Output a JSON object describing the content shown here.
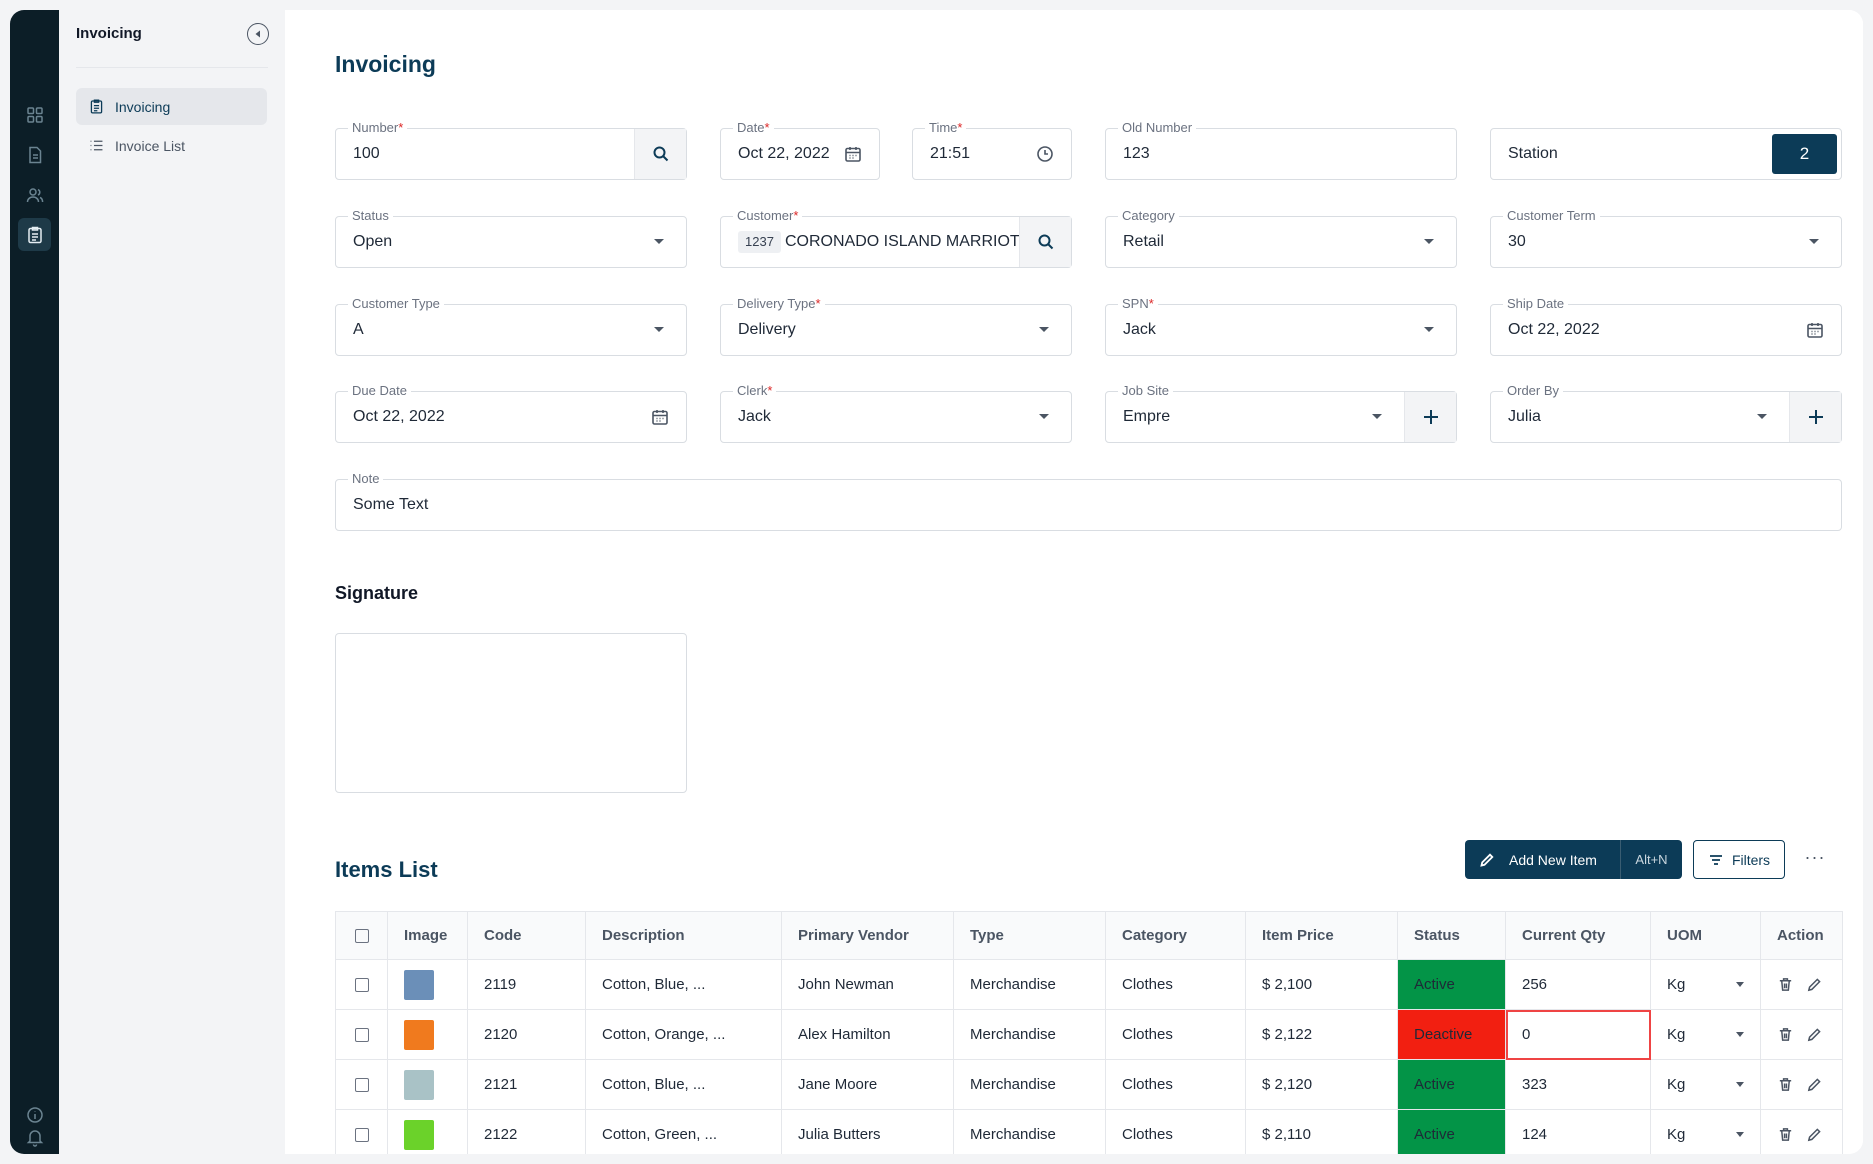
{
  "sidebar": {
    "title": "Invoicing",
    "items": [
      {
        "label": "Invoicing",
        "icon": "clipboard-icon",
        "active": true
      },
      {
        "label": "Invoice List",
        "icon": "list-icon",
        "active": false
      }
    ]
  },
  "rail": {
    "icons": [
      "grid-icon",
      "document-icon",
      "users-icon",
      "clipboard-icon",
      "info-icon",
      "bell-icon"
    ]
  },
  "page": {
    "title": "Invoicing"
  },
  "form": {
    "number": {
      "label": "Number",
      "value": "100"
    },
    "date": {
      "label": "Date",
      "value": "Oct 22, 2022"
    },
    "time": {
      "label": "Time",
      "value": "21:51"
    },
    "old_number": {
      "label": "Old Number",
      "value": "123"
    },
    "station": {
      "label": "Station",
      "value": "2"
    },
    "status": {
      "label": "Status",
      "value": "Open"
    },
    "customer": {
      "label": "Customer",
      "code": "1237",
      "value": "CORONADO ISLAND MARRIOTT"
    },
    "category": {
      "label": "Category",
      "value": "Retail"
    },
    "customer_term": {
      "label": "Customer Term",
      "value": "30"
    },
    "customer_type": {
      "label": "Customer Type",
      "value": "A"
    },
    "delivery_type": {
      "label": "Delivery Type",
      "value": "Delivery"
    },
    "spn": {
      "label": "SPN",
      "value": "Jack"
    },
    "ship_date": {
      "label": "Ship Date",
      "value": "Oct 22, 2022"
    },
    "due_date": {
      "label": "Due Date",
      "value": "Oct 22, 2022"
    },
    "clerk": {
      "label": "Clerk",
      "value": "Jack"
    },
    "job_site": {
      "label": "Job Site",
      "value": "Empre"
    },
    "order_by": {
      "label": "Order By",
      "value": "Julia"
    },
    "note": {
      "label": "Note",
      "value": "Some Text"
    }
  },
  "signature": {
    "title": "Signature"
  },
  "items": {
    "title": "Items List",
    "add_label": "Add New Item",
    "add_shortcut": "Alt+N",
    "filters_label": "Filters",
    "more_label": "···",
    "columns": [
      "Image",
      "Code",
      "Description",
      "Primary Vendor",
      "Type",
      "Category",
      "Item Price",
      "Status",
      "Current Qty",
      "UOM",
      "Action"
    ],
    "rows": [
      {
        "code": "2119",
        "description": "Cotton, Blue, ...",
        "vendor": "John Newman",
        "type": "Merchandise",
        "category": "Clothes",
        "price": "$ 2,100",
        "status": "Active",
        "qty": "256",
        "uom": "Kg",
        "image_color": "#6b8fb8"
      },
      {
        "code": "2120",
        "description": "Cotton, Orange, ...",
        "vendor": "Alex Hamilton",
        "type": "Merchandise",
        "category": "Clothes",
        "price": "$ 2,122",
        "status": "Deactive",
        "qty": "0",
        "uom": "Kg",
        "image_color": "#f07a1e"
      },
      {
        "code": "2121",
        "description": "Cotton, Blue, ...",
        "vendor": "Jane Moore",
        "type": "Merchandise",
        "category": "Clothes",
        "price": "$ 2,120",
        "status": "Active",
        "qty": "323",
        "uom": "Kg",
        "image_color": "#a9c2c6"
      },
      {
        "code": "2122",
        "description": "Cotton, Green, ...",
        "vendor": "Julia Butters",
        "type": "Merchandise",
        "category": "Clothes",
        "price": "$ 2,110",
        "status": "Active",
        "qty": "124",
        "uom": "Kg",
        "image_color": "#6bd22a"
      }
    ]
  },
  "colors": {
    "primary": "#0c3b57",
    "rail": "#0c1e27",
    "active": "#039447",
    "deactive": "#f21f11"
  }
}
